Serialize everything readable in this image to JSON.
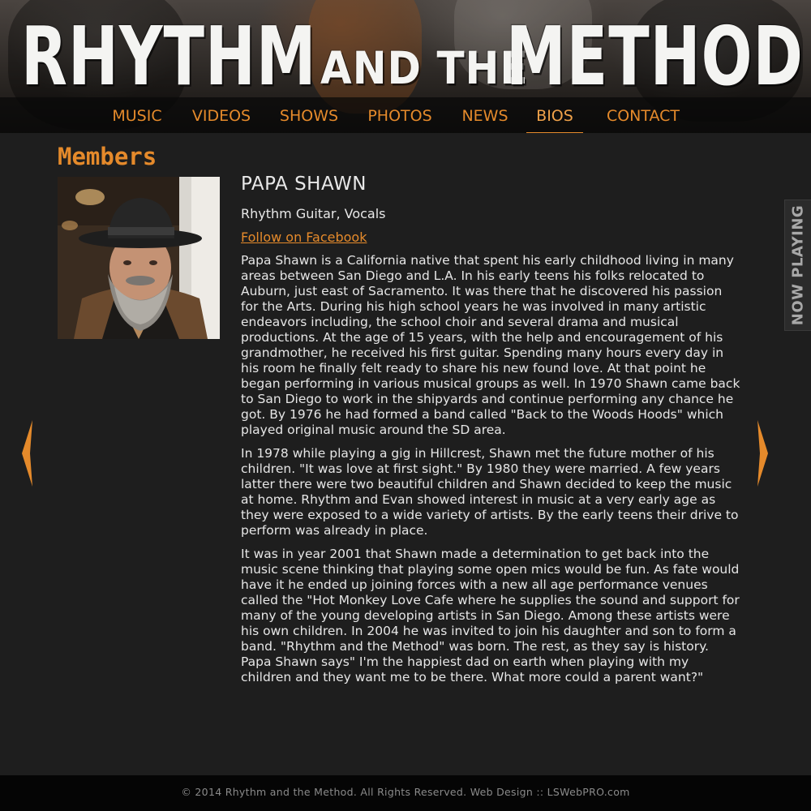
{
  "header": {
    "band_name_left": "RHYTHM",
    "band_name_mid": "AND THE",
    "band_name_right": "METHOD"
  },
  "nav": {
    "items": [
      {
        "label": "MUSIC"
      },
      {
        "label": "VIDEOS"
      },
      {
        "label": "SHOWS"
      },
      {
        "label": "PHOTOS"
      },
      {
        "label": "NEWS"
      },
      {
        "label": "BIOS",
        "active": true
      },
      {
        "label": "CONTACT"
      }
    ]
  },
  "page": {
    "heading": "Members"
  },
  "member": {
    "name": "PAPA SHAWN",
    "role": "Rhythm Guitar, Vocals",
    "facebook_label": "Follow on Facebook",
    "bio": [
      "Papa Shawn is a California native that spent his early childhood living in many areas between San Diego and L.A. In his early teens his folks relocated to Auburn, just east of Sacramento. It was there that he discovered his passion for the Arts. During his high school years he was involved in many artistic endeavors including, the school choir and several drama and musical productions. At the age of 15 years, with the help and encouragement of his grandmother, he received his first guitar. Spending many hours every day in his room he finally felt ready to share his new found love. At that point he began performing in various musical groups as well. In 1970 Shawn came back to San Diego to work in the shipyards and continue performing any chance he got. By 1976 he had formed a band called \"Back to the Woods Hoods\" which played original music around the SD area.",
      "In 1978 while playing a gig in Hillcrest, Shawn met the future mother of his children. \"It was love at first sight.\" By 1980 they were married. A few years latter there were two beautiful children and Shawn decided to keep the music at home. Rhythm and Evan showed interest in music at a very early age as they were exposed to a wide variety of artists. By the early teens their drive to perform was already in place.",
      "It was in year 2001 that Shawn made a determination to get back into the music scene thinking that playing some open mics would be fun. As fate would have it he ended up joining forces with a new all age performance venues called the \"Hot Monkey Love Cafe where he supplies the sound and support for many of the young developing artists in San Diego. Among these artists were his own children. In 2004 he was invited to join his daughter and son to form a band. \"Rhythm and the Method\" was born. The rest, as they say is history. Papa Shawn says\" I'm the happiest dad on earth when playing with my children and they want me to be there. What more could a parent want?\""
    ]
  },
  "now_playing": {
    "label": "NOW PLAYING"
  },
  "footer": {
    "text": "© 2014 Rhythm and the Method. All Rights Reserved. Web Design :: LSWebPRO.com"
  },
  "colors": {
    "accent": "#e58a2b",
    "background": "#1e1e1e",
    "text": "#e8e8e8",
    "footer_bg": "#050505"
  },
  "icons": {
    "previous": "triangle-left-icon",
    "next": "triangle-right-icon"
  }
}
